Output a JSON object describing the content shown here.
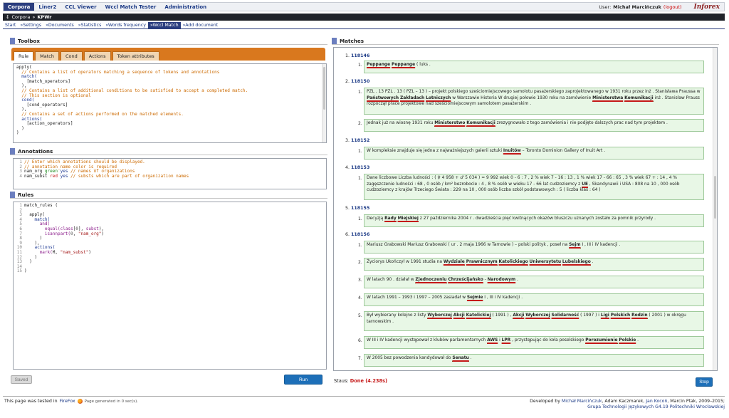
{
  "topbar": {
    "tabs": [
      "Corpora",
      "Liner2",
      "CCL Viewer",
      "Wccl Match Tester",
      "Administration"
    ],
    "user_label": "User:",
    "user_name": "Michał Marcińczuk",
    "logout": "(logout)",
    "logo": "Inforex"
  },
  "breadcrumb": {
    "arrow": "↕",
    "root": "Corpora",
    "sep": "»",
    "current": "KPWr"
  },
  "subnav": [
    "Start",
    "»Settings",
    "»Documents",
    "»Statistics",
    "»Words frequency",
    "»Wccl Match",
    "»Add document"
  ],
  "toolbox": {
    "title": "Toolbox",
    "tabs": [
      "Rule",
      "Match",
      "Cond",
      "Actions",
      "Token attributes"
    ]
  },
  "annotations": {
    "title": "Annotations"
  },
  "rules": {
    "title": "Rules"
  },
  "buttons": {
    "saved": "Saved",
    "run": "Run",
    "stop": "Stop"
  },
  "matches": {
    "title": "Matches",
    "groups": [
      {
        "num": "1.",
        "id": "118146"
      },
      {
        "num": "2.",
        "id": "118150"
      },
      {
        "num": "3.",
        "id": "118152"
      },
      {
        "num": "4.",
        "id": "118153"
      },
      {
        "num": "5.",
        "id": "118155"
      },
      {
        "num": "6.",
        "id": "118156"
      }
    ]
  },
  "status": {
    "label": "Staus:",
    "value": "Done (4.238s)"
  },
  "footer": {
    "tested": "This page was tested in",
    "browser": "FireFox",
    "generated": "Page generated in 0 sec(s).",
    "developed": "Developed by",
    "dev1": "Michał Marcińczuk",
    "dev2": ", Adam Kaczmarek,",
    "dev3": "Jan Kocoń",
    "dev4": ", Marcin Ptak, 2009–2015;",
    "group": "Grupa Technologii Językowych G4.19 Politechniki Wrocławskiej"
  },
  "colors": {
    "accent": "#2a3d7e",
    "toolbar_orange": "#d9781e",
    "match_bg": "#e8f7e6",
    "run_blue": "#1d6fb8"
  }
}
